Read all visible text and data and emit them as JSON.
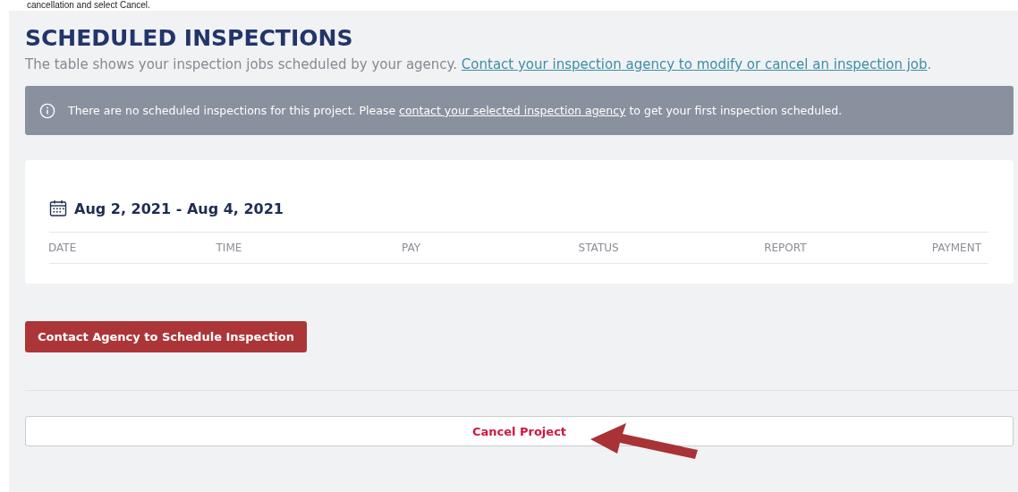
{
  "caption": "cancellation and select Cancel.",
  "section": {
    "title": "SCHEDULED INSPECTIONS",
    "description": "The table shows your inspection jobs scheduled by your agency.",
    "description_link": "Contact your inspection agency to modify or cancel an inspection job",
    "description_end": "."
  },
  "alert": {
    "text_before": "There are no scheduled inspections for this project. Please",
    "link": "contact your selected inspection agency",
    "text_after": "to get your first inspection scheduled."
  },
  "schedule": {
    "date_range": "Aug 2, 2021 - Aug 4, 2021",
    "columns": [
      "DATE",
      "TIME",
      "PAY",
      "STATUS",
      "REPORT",
      "PAYMENT"
    ]
  },
  "primary_button": "Contact Agency to Schedule Inspection",
  "cancel_button": "Cancel Project"
}
